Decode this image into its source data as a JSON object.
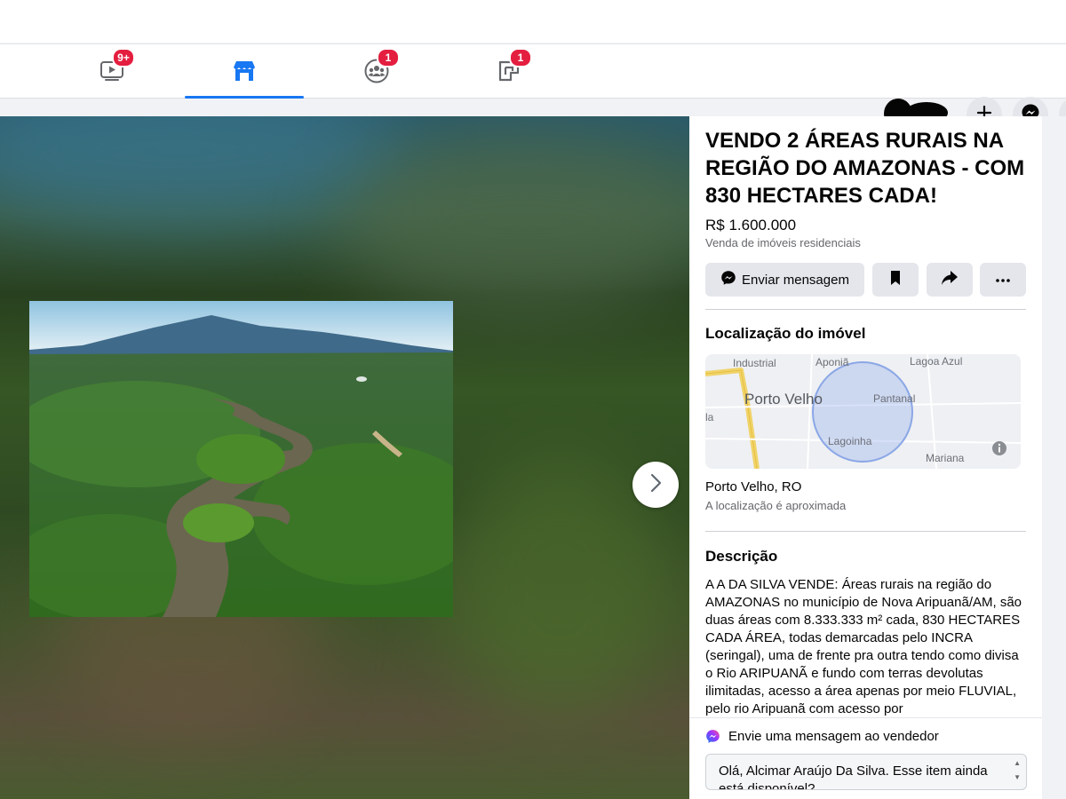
{
  "nav": {
    "tabs": [
      {
        "name": "watch",
        "icon": "video-icon",
        "badge": "9+",
        "active": false
      },
      {
        "name": "marketplace",
        "icon": "marketplace-icon",
        "badge": "",
        "active": true
      },
      {
        "name": "groups",
        "icon": "groups-icon",
        "badge": "1",
        "active": false
      },
      {
        "name": "gaming",
        "icon": "gaming-icon",
        "badge": "1",
        "active": false
      }
    ],
    "right_buttons": [
      "plus-icon",
      "messenger-icon"
    ]
  },
  "listing": {
    "title": "VENDO 2 ÁREAS RURAIS NA REGIÃO DO AMAZONAS - COM 830 HECTARES CADA!",
    "price": "R$ 1.600.000",
    "category": "Venda de imóveis residenciais",
    "actions": {
      "send_message": "Enviar mensagem",
      "save_icon": "bookmark-icon",
      "share_icon": "share-icon",
      "more_icon": "more-icon"
    }
  },
  "location": {
    "heading": "Localização do imóvel",
    "map_labels": {
      "industrial": "Industrial",
      "aponia": "Aponiã",
      "lagoa_azul": "Lagoa Azul",
      "porto_velho": "Porto Velho",
      "pantanal": "Pantanal",
      "la": "la",
      "lagoinha": "Lagoinha",
      "mariana": "Mariana"
    },
    "place": "Porto Velho, RO",
    "note": "A localização é aproximada"
  },
  "description": {
    "heading": "Descrição",
    "text": "A A DA SILVA VENDE: Áreas rurais na região do AMAZONAS no município de Nova Aripuanã/AM, são duas áreas com 8.333.333 m² cada,  830 HECTARES CADA ÁREA, todas demarcadas pelo INCRA (seringal),  uma de frente pra outra tendo como divisa o Rio ARIPUANÃ e fundo com terras devolutas ilimitadas, acesso a área apenas por meio FLUVIAL, pelo rio Aripuanã com acesso por"
  },
  "message": {
    "heading": "Envie uma mensagem ao vendedor",
    "draft": "Olá, Alcimar Araújo Da Silva. Esse item ainda está disponível?"
  },
  "colors": {
    "accent": "#1877f2",
    "badge": "#e41e3f",
    "button_bg": "#e4e6eb"
  }
}
